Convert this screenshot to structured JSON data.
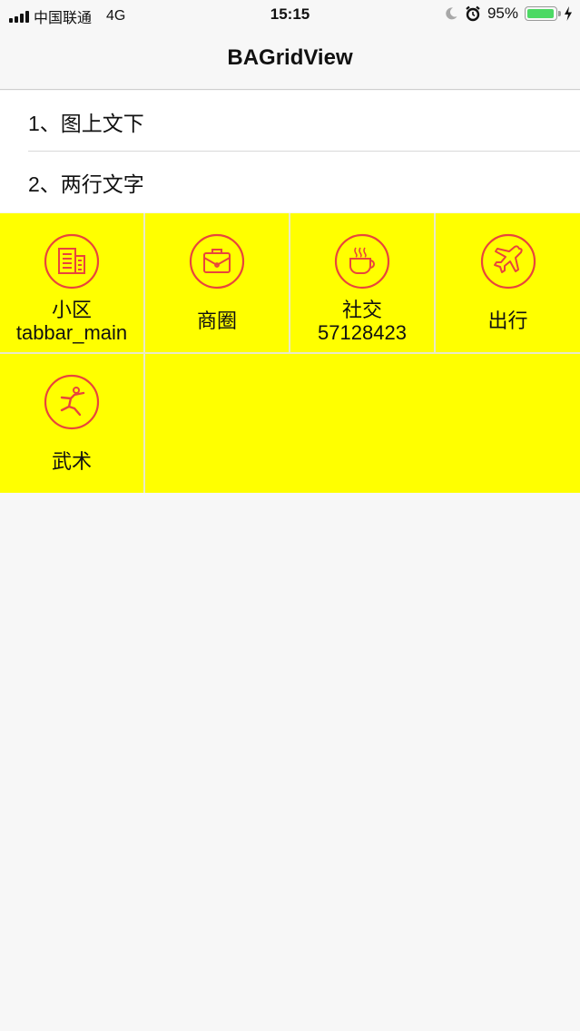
{
  "status_bar": {
    "carrier": "中国联通",
    "network": "4G",
    "time": "15:15",
    "battery_percent": "95%",
    "battery_level": 0.95,
    "icons": [
      "signal-icon",
      "moon-icon",
      "alarm-icon",
      "battery-icon",
      "charging-icon"
    ]
  },
  "nav": {
    "title": "BAGridView"
  },
  "list": {
    "items": [
      {
        "label": "1、图上文下"
      },
      {
        "label": "2、两行文字"
      }
    ]
  },
  "grid": {
    "background": "#ffff00",
    "icon_color": "#e8453c",
    "items": [
      {
        "title": "小区",
        "subtitle": "tabbar_main",
        "icon": "building-icon"
      },
      {
        "title": "商圈",
        "subtitle": "",
        "icon": "briefcase-icon"
      },
      {
        "title": "社交",
        "subtitle": "57128423",
        "icon": "coffee-cup-icon"
      },
      {
        "title": "出行",
        "subtitle": "",
        "icon": "airplane-icon"
      },
      {
        "title": "武术",
        "subtitle": "",
        "icon": "martial-arts-icon"
      }
    ]
  }
}
